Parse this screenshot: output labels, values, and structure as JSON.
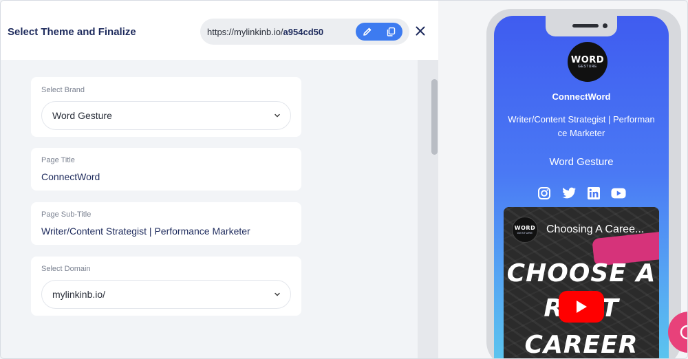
{
  "header": {
    "title": "Select Theme and Finalize",
    "url_prefix": "https://mylinkinb.io/",
    "url_slug": "a954cd50"
  },
  "form": {
    "brand": {
      "label": "Select Brand",
      "value": "Word Gesture"
    },
    "page_title": {
      "label": "Page Title",
      "value": "ConnectWord"
    },
    "page_subtitle": {
      "label": "Page Sub-Title",
      "value": "Writer/Content Strategist | Performance Marketer"
    },
    "domain": {
      "label": "Select Domain",
      "value": "mylinkinb.io/"
    }
  },
  "preview": {
    "logo_top": "WORD",
    "logo_bottom": "GESTURE",
    "name": "ConnectWord",
    "subtitle_line1": "Writer/Content Strategist | Performan",
    "subtitle_line2": "ce Marketer",
    "brand": "Word Gesture",
    "socials": [
      "instagram-icon",
      "twitter-icon",
      "linkedin-icon",
      "youtube-icon"
    ],
    "video": {
      "title": "Choosing A Caree...",
      "line1": "CHOOSE A",
      "line2": "R   IT",
      "line3": "CAREER"
    }
  },
  "colors": {
    "accent": "#3d7bf0",
    "title": "#1d2a5c",
    "fab": "#e8417a"
  }
}
